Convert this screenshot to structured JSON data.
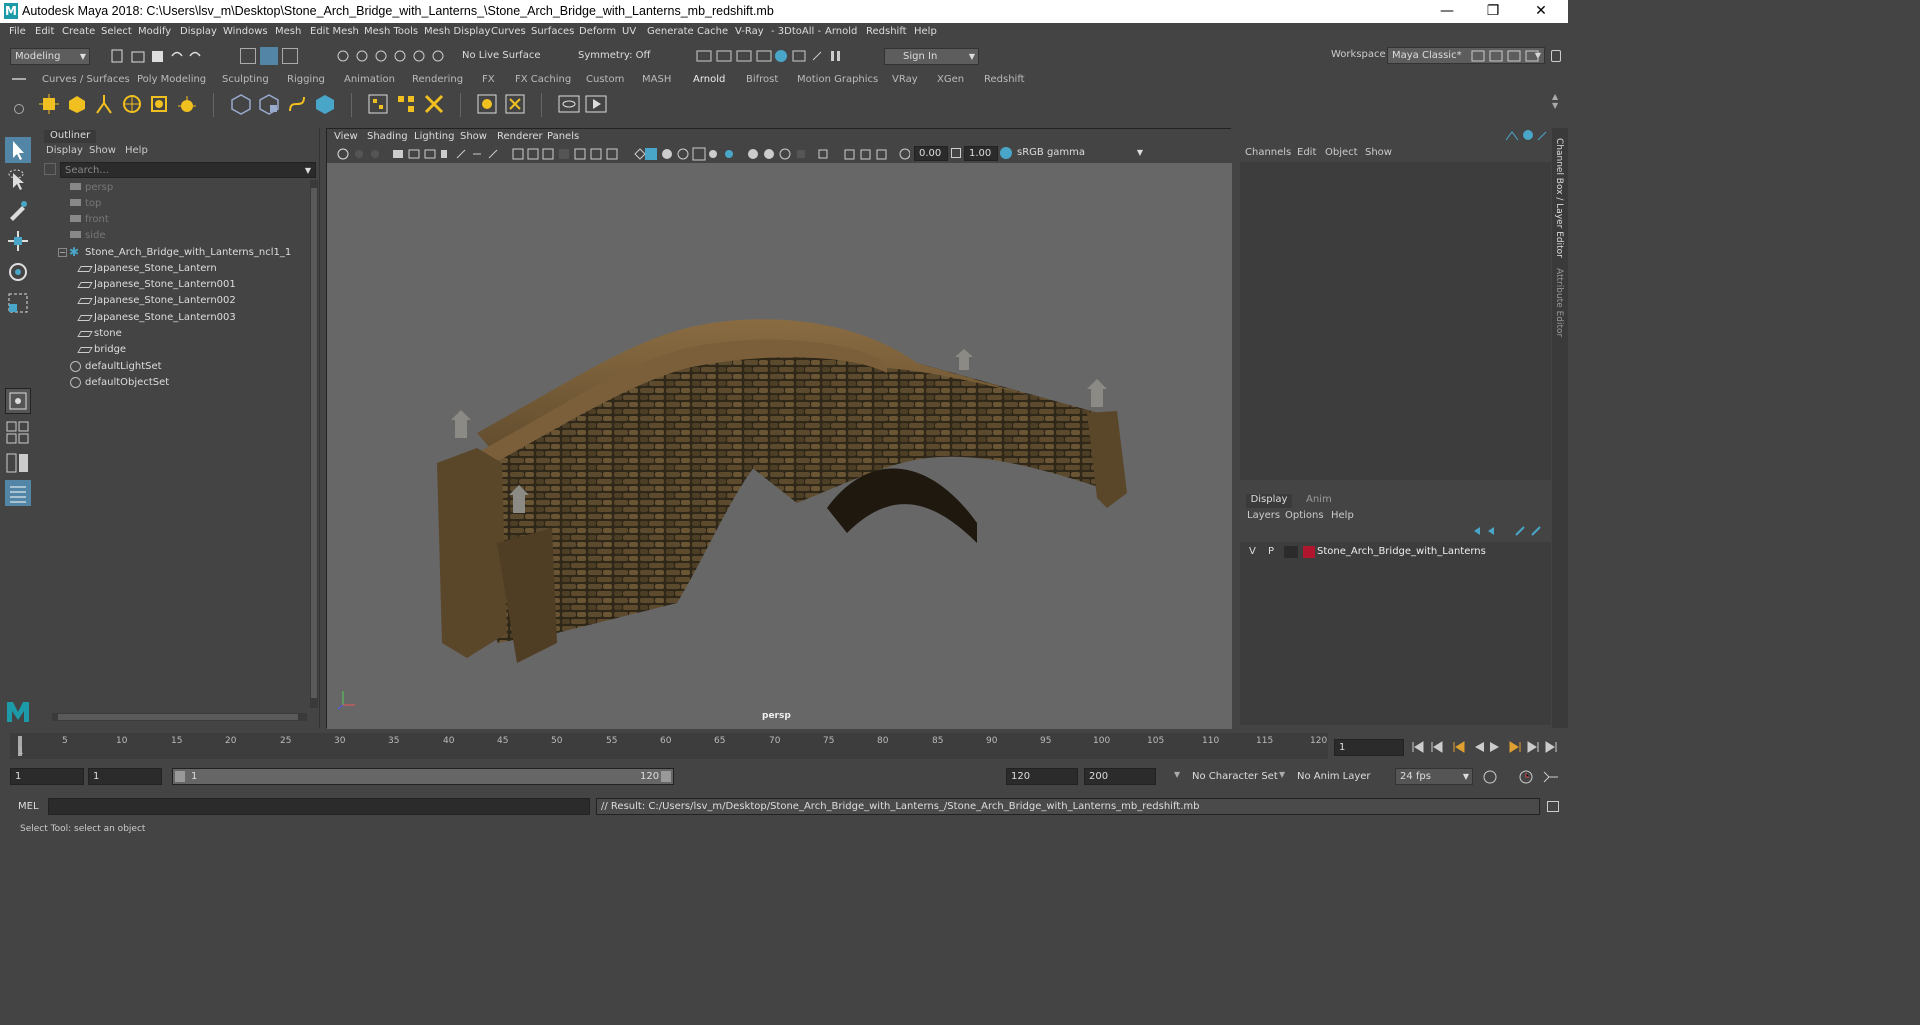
{
  "window": {
    "title": "Autodesk Maya 2018: C:\\Users\\lsv_m\\Desktop\\Stone_Arch_Bridge_with_Lanterns_\\Stone_Arch_Bridge_with_Lanterns_mb_redshift.mb"
  },
  "menu": [
    "File",
    "Edit",
    "Create",
    "Select",
    "Modify",
    "Display",
    "Windows",
    "Mesh",
    "Edit Mesh",
    "Mesh Tools",
    "Mesh Display",
    "Curves",
    "Surfaces",
    "Deform",
    "UV",
    "Generate",
    "Cache",
    "V-Ray",
    "- 3DtoAll -",
    "Arnold",
    "Redshift",
    "Help"
  ],
  "status": {
    "mode": "Modeling",
    "live_surface": "No Live Surface",
    "symmetry": "Symmetry: Off",
    "sign_in": "Sign In",
    "workspace_label": "Workspace :",
    "workspace": "Maya Classic*"
  },
  "shelf_tabs": [
    "Curves / Surfaces",
    "Poly Modeling",
    "Sculpting",
    "Rigging",
    "Animation",
    "Rendering",
    "FX",
    "FX Caching",
    "Custom",
    "MASH",
    "Arnold",
    "Bifrost",
    "Motion Graphics",
    "VRay",
    "XGen",
    "Redshift"
  ],
  "shelf_active": "Arnold",
  "outliner": {
    "title": "Outliner",
    "menu": [
      "Display",
      "Show",
      "Help"
    ],
    "search_placeholder": "Search...",
    "items": [
      {
        "label": "persp",
        "type": "camera",
        "indent": 0
      },
      {
        "label": "top",
        "type": "camera",
        "indent": 0
      },
      {
        "label": "front",
        "type": "camera",
        "indent": 0
      },
      {
        "label": "side",
        "type": "camera",
        "indent": 0
      },
      {
        "label": "Stone_Arch_Bridge_with_Lanterns_ncl1_1",
        "type": "group",
        "indent": 0
      },
      {
        "label": "Japanese_Stone_Lantern",
        "type": "mesh",
        "indent": 1
      },
      {
        "label": "Japanese_Stone_Lantern001",
        "type": "mesh",
        "indent": 1
      },
      {
        "label": "Japanese_Stone_Lantern002",
        "type": "mesh",
        "indent": 1
      },
      {
        "label": "Japanese_Stone_Lantern003",
        "type": "mesh",
        "indent": 1
      },
      {
        "label": "stone",
        "type": "mesh",
        "indent": 1
      },
      {
        "label": "bridge",
        "type": "mesh",
        "indent": 1
      },
      {
        "label": "defaultLightSet",
        "type": "set",
        "indent": 0
      },
      {
        "label": "defaultObjectSet",
        "type": "set",
        "indent": 0
      }
    ]
  },
  "viewport": {
    "menu": [
      "View",
      "Shading",
      "Lighting",
      "Show",
      "Renderer",
      "Panels"
    ],
    "exposure": "0.00",
    "gamma": "1.00",
    "color_space": "sRGB gamma",
    "camera_label": "persp"
  },
  "channel_box": {
    "menu": [
      "Channels",
      "Edit",
      "Object",
      "Show"
    ]
  },
  "layer_editor": {
    "tabs": [
      "Display",
      "Anim"
    ],
    "menu": [
      "Layers",
      "Options",
      "Help"
    ],
    "layers": [
      {
        "v": "V",
        "p": "P",
        "name": "Stone_Arch_Bridge_with_Lanterns",
        "color": "#b0162d"
      }
    ]
  },
  "side_tabs": [
    "Channel Box / Layer Editor",
    "Attribute Editor"
  ],
  "timeline": {
    "ticks": [
      "5",
      "10",
      "15",
      "20",
      "25",
      "30",
      "35",
      "40",
      "45",
      "50",
      "55",
      "60",
      "65",
      "70",
      "75",
      "80",
      "85",
      "90",
      "95",
      "100",
      "105",
      "110",
      "115",
      "120"
    ],
    "current_frame": "1",
    "start_marker": "1"
  },
  "range": {
    "start": "1",
    "playback_start": "1",
    "slider_start": "1",
    "slider_end": "120",
    "playback_end": "120",
    "end": "200",
    "character_set": "No Character Set",
    "anim_layer": "No Anim Layer",
    "fps": "24 fps"
  },
  "command": {
    "label": "MEL",
    "result": "// Result: C:/Users/lsv_m/Desktop/Stone_Arch_Bridge_with_Lanterns_/Stone_Arch_Bridge_with_Lanterns_mb_redshift.mb"
  },
  "help_line": "Select Tool: select an object",
  "colors": {
    "accent": "#5285a6",
    "active_tool": "#5285a6",
    "bg": "#444444",
    "viewport_bg": "#676767"
  }
}
